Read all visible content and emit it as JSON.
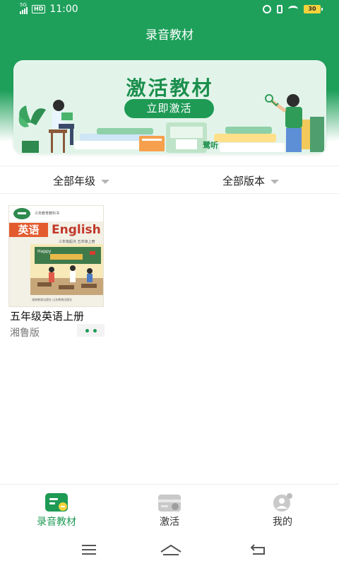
{
  "status_bar": {
    "network": "5G",
    "hd": "HD",
    "time": "11:00",
    "battery": "30",
    "icons": [
      "signal-icon",
      "alarm-icon",
      "vibrate-icon",
      "wifi-icon",
      "battery-icon"
    ]
  },
  "header": {
    "title": "录音教材"
  },
  "banner": {
    "title": "激活教材",
    "button_label": "立即激活",
    "logo_text": "鹭听"
  },
  "filters": {
    "grade_label": "全部年级",
    "edition_label": "全部版本"
  },
  "books": [
    {
      "title": "五年级英语上册",
      "edition": "湘鲁版",
      "cover": {
        "series_text": "义务教育教科书",
        "subject": "英语",
        "english": "English",
        "grade_text": "三年级起点 五年级上册",
        "scene_text": "Happy Children's Day",
        "publisher_text": "湖南教育出版社 山东教育出版社"
      }
    }
  ],
  "bottom_nav": {
    "items": [
      {
        "label": "录音教材",
        "icon": "textbook-icon",
        "active": true
      },
      {
        "label": "激活",
        "icon": "activate-icon",
        "active": false
      },
      {
        "label": "我的",
        "icon": "profile-icon",
        "active": false
      }
    ]
  },
  "colors": {
    "primary": "#1ea05b",
    "active": "#1e9a55",
    "banner_bg": "#e2f4ea"
  }
}
